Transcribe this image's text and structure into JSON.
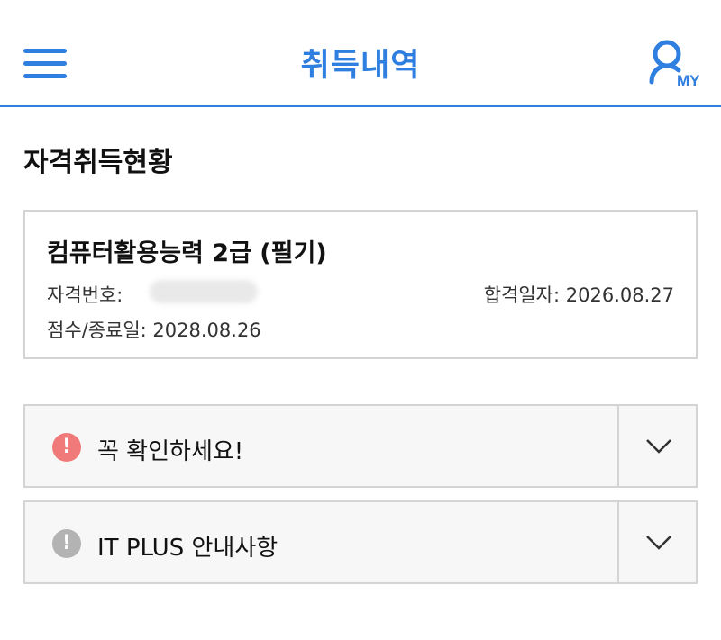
{
  "header": {
    "title": "취득내역",
    "my_label": "MY",
    "accent_color": "#2f7fe0"
  },
  "section": {
    "title": "자격취득현황"
  },
  "certificate": {
    "name": "컴퓨터활용능력 2급 (필기)",
    "number_label": "자격번호:",
    "pass_date_label": "합격일자: 2026.08.27",
    "expiry_label": "점수/종료일: 2028.08.26"
  },
  "accordions": [
    {
      "icon": "!",
      "label": "꼭 확인하세요!",
      "icon_color": "#f07a7a"
    },
    {
      "icon": "!",
      "label": "IT PLUS 안내사항",
      "icon_color": "#b3b3b3"
    }
  ]
}
